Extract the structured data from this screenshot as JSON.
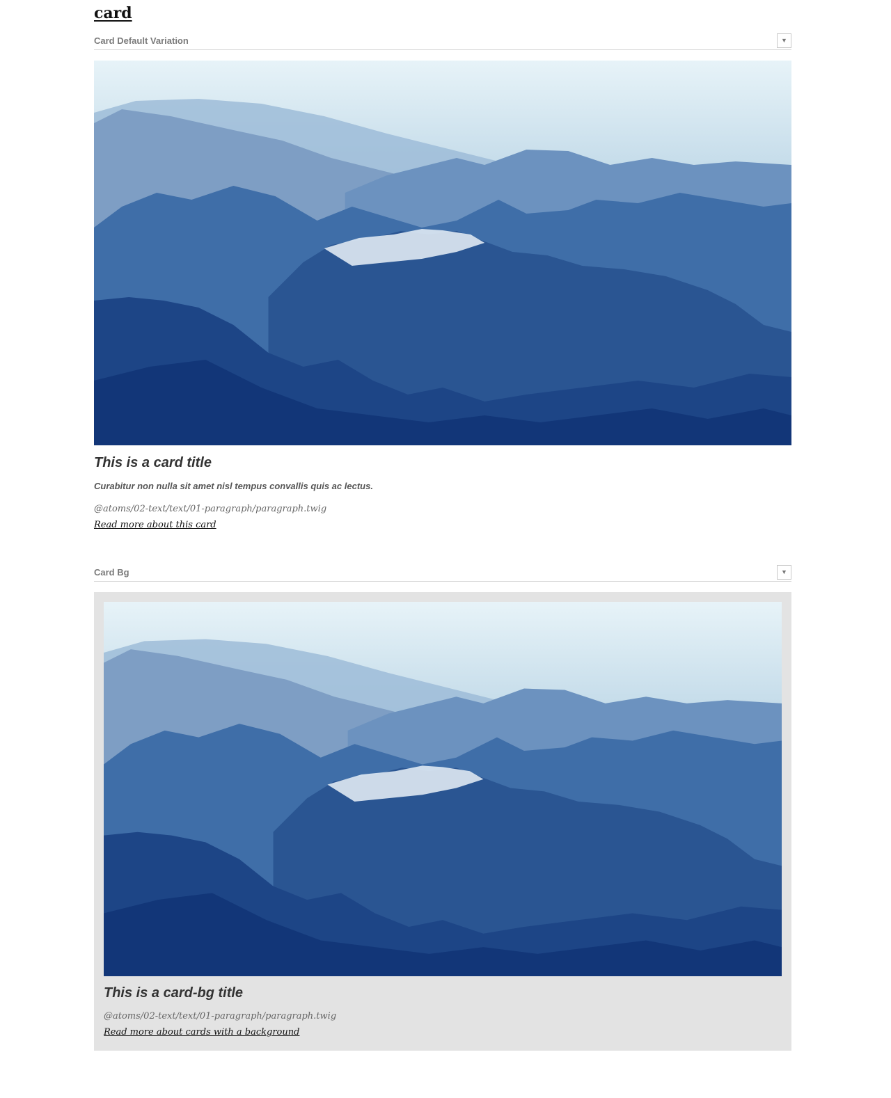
{
  "page": {
    "title": "card"
  },
  "sections": [
    {
      "label": "Card Default Variation",
      "toggle_icon": "▼",
      "card": {
        "image_alt": "Aerial view of blue mountain ranges",
        "title": "This is a card title",
        "subtitle": "Curabitur non nulla sit amet nisl tempus convallis quis ac lectus.",
        "path": "@atoms/02-text/text/01-paragraph/paragraph.twig",
        "link": "Read more about this card"
      }
    },
    {
      "label": "Card Bg",
      "toggle_icon": "▼",
      "card": {
        "image_alt": "Aerial view of blue mountain ranges",
        "title": "This is a card-bg title",
        "path": "@atoms/02-text/text/01-paragraph/paragraph.twig",
        "link": "Read more about cards with a background",
        "background_color": "#e3e3e3"
      }
    }
  ]
}
